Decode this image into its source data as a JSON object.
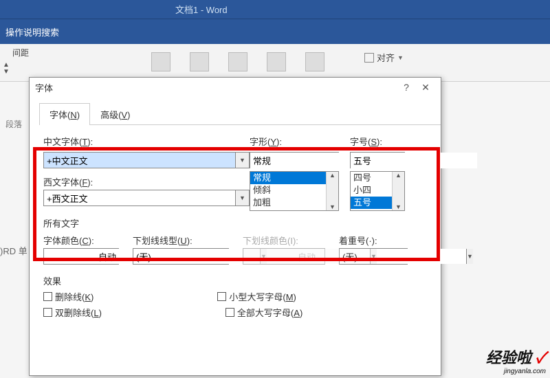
{
  "titlebar": {
    "title": "文档1 - Word"
  },
  "ribbon": {
    "search_hint": "操作说明搜索",
    "tab": "间距",
    "paragraph_group": "段落",
    "align_label": "对齐"
  },
  "dialog": {
    "title": "字体",
    "help": "?",
    "tabs": {
      "font": {
        "prefix": "字体(",
        "key": "N",
        "suffix": ")"
      },
      "advanced": {
        "prefix": "高级(",
        "key": "V",
        "suffix": ")"
      }
    },
    "labels": {
      "cn_font": {
        "prefix": "中文字体(",
        "key": "T",
        "suffix": "):"
      },
      "west_font": {
        "prefix": "西文字体(",
        "key": "F",
        "suffix": "):"
      },
      "style": {
        "prefix": "字形(",
        "key": "Y",
        "suffix": "):"
      },
      "size": {
        "prefix": "字号(",
        "key": "S",
        "suffix": "):"
      }
    },
    "values": {
      "cn_font": "+中文正文",
      "west_font": "+西文正文",
      "style": "常规",
      "size": "五号"
    },
    "style_list": [
      "常规",
      "倾斜",
      "加粗"
    ],
    "size_list": [
      "四号",
      "小四",
      "五号"
    ],
    "all_chars": "所有文字",
    "font_color": {
      "prefix": "字体颜色(",
      "key": "C",
      "suffix": "):",
      "value": "自动"
    },
    "underline_style": {
      "prefix": "下划线线型(",
      "key": "U",
      "suffix": "):",
      "value": "(无)"
    },
    "underline_color": {
      "label": "下划线颜色(I):",
      "value": "自动"
    },
    "emphasis": {
      "label": "着重号(·):",
      "value": "(无)"
    },
    "effects_title": "效果",
    "effects": {
      "strike": {
        "prefix": "删除线(",
        "key": "K",
        "suffix": ")"
      },
      "dstrike": {
        "prefix": "双删除线(",
        "key": "L",
        "suffix": ")"
      },
      "smallcaps": {
        "prefix": "小型大写字母(",
        "key": "M",
        "suffix": ")"
      },
      "allcaps": {
        "prefix": "全部大写字母(",
        "key": "A",
        "suffix": ")"
      }
    }
  },
  "doc_bg": ")RD 单",
  "watermark": {
    "big": "经验啦",
    "small": "jingyanla.com"
  }
}
